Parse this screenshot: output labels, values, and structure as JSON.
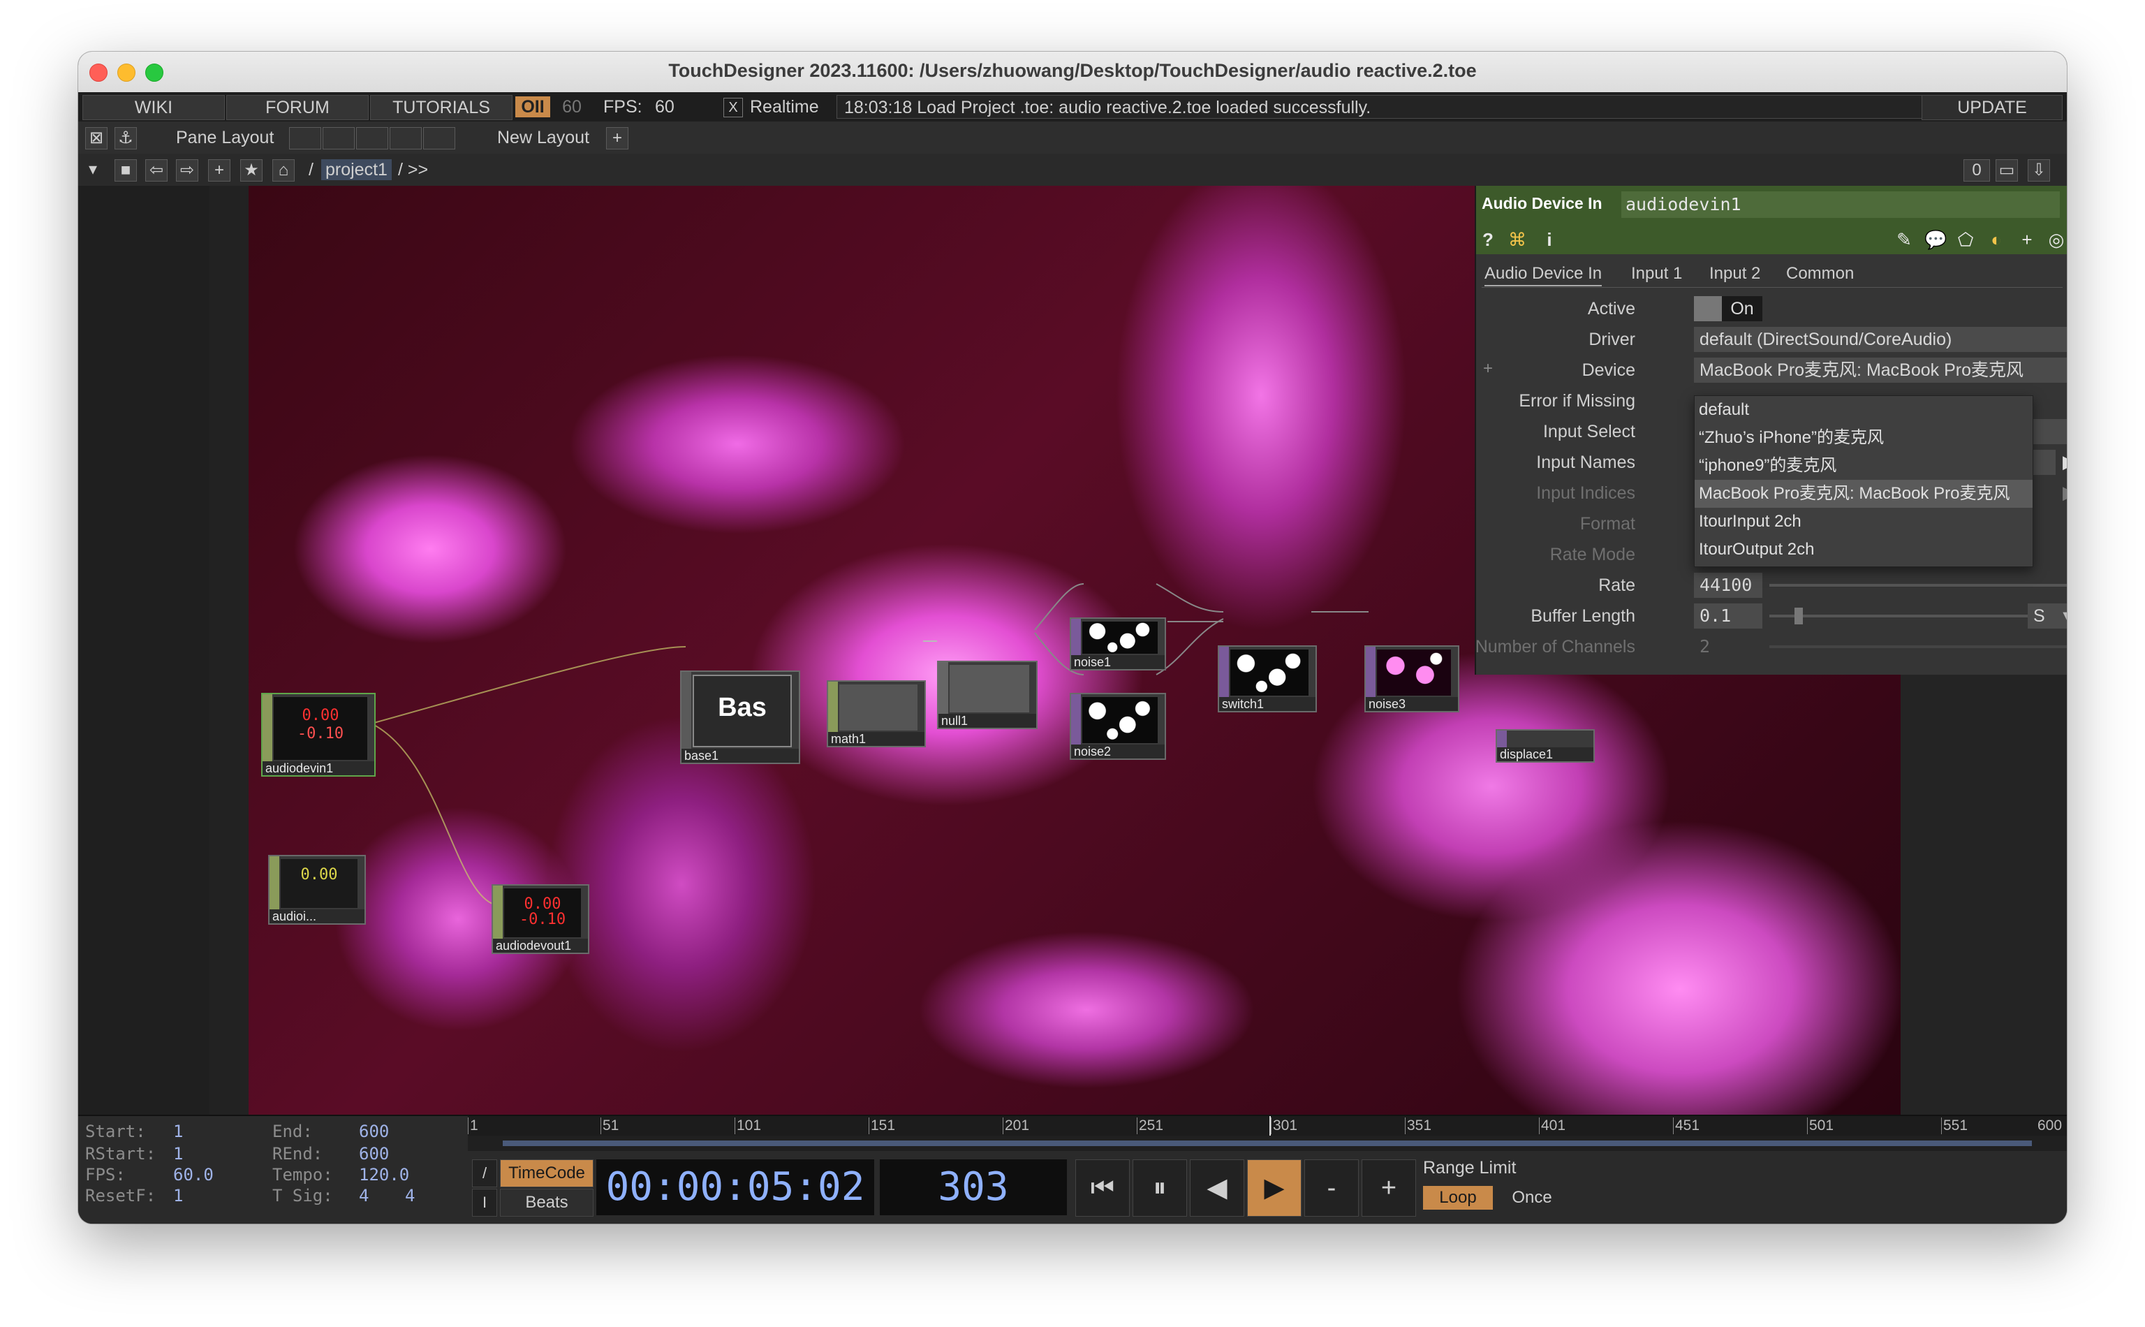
{
  "window": {
    "title": "TouchDesigner 2023.11600: /Users/zhuowang/Desktop/TouchDesigner/audio reactive.2.toe"
  },
  "menubar": {
    "wiki": "WIKI",
    "forum": "FORUM",
    "tutorials": "TUTORIALS",
    "op_badge": "OII",
    "fps_count": "60",
    "fps_label": "FPS:",
    "fps_value": "60",
    "realtime_check": "X",
    "realtime_label": "Realtime",
    "status": "18:03:18 Load Project .toe: audio reactive.2.toe loaded successfully.",
    "update": "UPDATE"
  },
  "toolbar1": {
    "pane_layout": "Pane Layout",
    "new_layout": "New Layout",
    "add": "+"
  },
  "toolbar2": {
    "path_sep": "/",
    "path_current": "project1",
    "path_more": "/ >>",
    "right_count": "0"
  },
  "nodes": {
    "audiodevin": {
      "label": "audiodevin1",
      "v1": "0.00",
      "v2": "-0.10"
    },
    "audioin2": {
      "label": "audioi..."
    },
    "audiodevout": {
      "label": "audiodevout1",
      "v1": "0.00",
      "v2": "-0.10"
    },
    "base": {
      "label": "base1",
      "tile": "Bas"
    },
    "math": {
      "label": "math1"
    },
    "null": {
      "label": "null1"
    },
    "noise1": {
      "label": "noise1"
    },
    "noise2": {
      "label": "noise2"
    },
    "switch": {
      "label": "switch1"
    },
    "noise3": {
      "label": "noise3"
    },
    "displace": {
      "label": "displace1"
    }
  },
  "param": {
    "op_type": "Audio Device In",
    "op_name": "audiodevin1",
    "tabs": [
      "Audio Device In",
      "Input 1",
      "Input 2",
      "Common"
    ],
    "rows": {
      "active": {
        "label": "Active",
        "value": "On"
      },
      "driver": {
        "label": "Driver",
        "value": "default (DirectSound/CoreAudio)"
      },
      "device": {
        "label": "Device",
        "value": "MacBook Pro麦克风: MacBook Pro麦克风"
      },
      "error": {
        "label": "Error if Missing"
      },
      "input_select": {
        "label": "Input Select"
      },
      "input_names": {
        "label": "Input Names"
      },
      "input_indices": {
        "label": "Input Indices"
      },
      "format": {
        "label": "Format"
      },
      "rate_mode": {
        "label": "Rate Mode"
      },
      "rate": {
        "label": "Rate",
        "value": "44100"
      },
      "buffer": {
        "label": "Buffer Length",
        "value": "0.1",
        "unit": "S"
      },
      "channels": {
        "label": "Number of Channels",
        "value": "2"
      }
    },
    "device_options": [
      "default",
      "“Zhuo’s iPhone”的麦克风",
      "“iphone9”的麦克风",
      "MacBook Pro麦克风: MacBook Pro麦克风",
      "ItourInput 2ch",
      "ItourOutput 2ch"
    ],
    "selected_option_index": 3
  },
  "timeline": {
    "start_k": "Start:",
    "start_v": "1",
    "end_k": "End:",
    "end_v": "600",
    "rstart_k": "RStart:",
    "rstart_v": "1",
    "rend_k": "REnd:",
    "rend_v": "600",
    "fps_k": "FPS:",
    "fps_v": "60.0",
    "tempo_k": "Tempo:",
    "tempo_v": "120.0",
    "resetf_k": "ResetF:",
    "resetf_v": "1",
    "tsig_k": "T Sig:",
    "tsig_v1": "4",
    "tsig_v2": "4",
    "ruler_ticks": [
      "1",
      "51",
      "101",
      "151",
      "201",
      "251",
      "301",
      "351",
      "401",
      "451",
      "501",
      "551",
      "600"
    ],
    "timecode_btn": "TimeCode",
    "beats_btn": "Beats",
    "timecode": "00:00:05:02",
    "frame": "303",
    "range_limit": "Range Limit",
    "loop": "Loop",
    "once": "Once",
    "minus": "-",
    "plus": "+"
  },
  "colors": {
    "node_chop": "#8a9b5a",
    "node_top": "#7a5a9a",
    "param_header": "#3d5a2a",
    "accent_orange": "#c98a4a",
    "timecode_text": "#8fb1ff"
  }
}
